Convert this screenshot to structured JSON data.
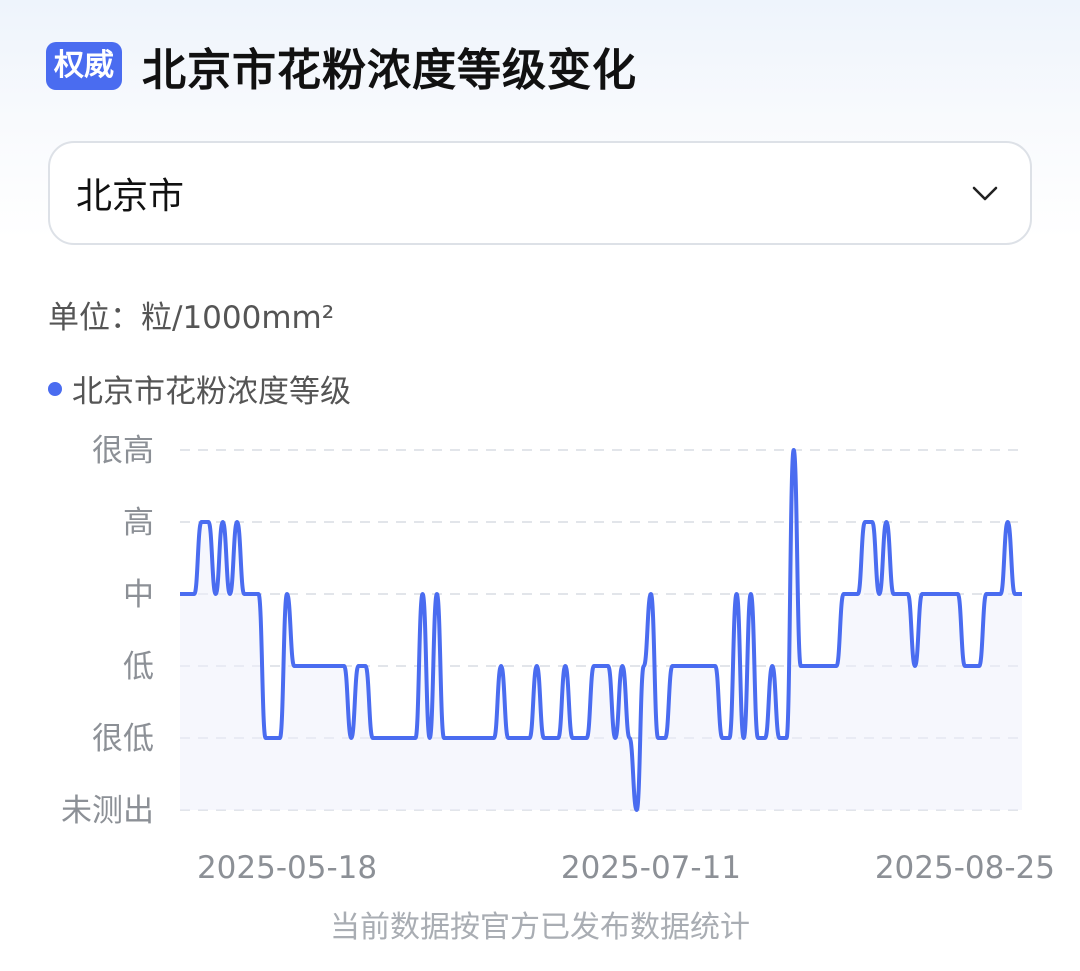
{
  "header": {
    "badge": "权威",
    "title": "北京市花粉浓度等级变化"
  },
  "selector": {
    "value": "北京市",
    "icon": "chevron-down-icon"
  },
  "unit_label": "单位：粒/1000mm²",
  "legend": {
    "label": "北京市花粉浓度等级",
    "color": "#4a6cf0"
  },
  "footer_note": "当前数据按官方已发布数据统计",
  "chart_data": {
    "type": "line",
    "title": "",
    "y_levels": [
      "未测出",
      "很低",
      "低",
      "中",
      "高",
      "很高"
    ],
    "x_tick_labels": [
      "2025-05-18",
      "2025-07-11",
      "2025-08-25"
    ],
    "series": [
      {
        "name": "北京市花粉浓度等级",
        "values": [
          3,
          3,
          3,
          4,
          4,
          3,
          4,
          3,
          4,
          3,
          3,
          3,
          1,
          1,
          1,
          3,
          2,
          2,
          2,
          2,
          2,
          2,
          2,
          2,
          1,
          2,
          2,
          1,
          1,
          1,
          1,
          1,
          1,
          1,
          3,
          1,
          3,
          1,
          1,
          1,
          1,
          1,
          1,
          1,
          1,
          2,
          1,
          1,
          1,
          1,
          2,
          1,
          1,
          1,
          2,
          1,
          1,
          1,
          2,
          2,
          2,
          1,
          2,
          1,
          0,
          2,
          3,
          1,
          1,
          2,
          2,
          2,
          2,
          2,
          2,
          2,
          1,
          1,
          3,
          1,
          3,
          1,
          1,
          2,
          1,
          1,
          5,
          2,
          2,
          2,
          2,
          2,
          2,
          3,
          3,
          3,
          4,
          4,
          3,
          4,
          3,
          3,
          3,
          2,
          3,
          3,
          3,
          3,
          3,
          3,
          2,
          2,
          2,
          3,
          3,
          3,
          4,
          3,
          3
        ]
      }
    ],
    "grid": "horizontal-dashed",
    "colors": {
      "line": "#4a6cf0",
      "grid": "#e2e5ea",
      "fill": "#eef1fb"
    }
  }
}
